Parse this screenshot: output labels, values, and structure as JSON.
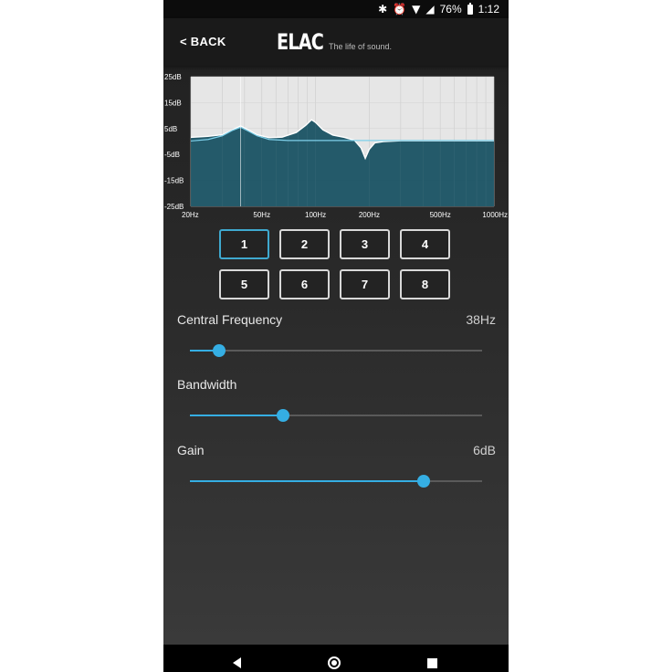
{
  "status_bar": {
    "battery_percent": "76%",
    "time": "1:12"
  },
  "header": {
    "back_label": "< BACK",
    "logo_text": "ELAC",
    "tagline": "The life of sound."
  },
  "chart_data": {
    "type": "area",
    "x_scale": "log",
    "xlim": [
      20,
      1000
    ],
    "ylim": [
      -25,
      25
    ],
    "x_ticks": [
      "20Hz",
      "50Hz",
      "100Hz",
      "200Hz",
      "500Hz",
      "1000Hz"
    ],
    "x_tick_values": [
      20,
      50,
      100,
      200,
      500,
      1000
    ],
    "y_ticks": [
      "25dB",
      "15dB",
      "5dB",
      "-5dB",
      "-15dB",
      "-25dB"
    ],
    "y_tick_values": [
      25,
      15,
      5,
      -5,
      -15,
      -25
    ],
    "grid": true,
    "selected_frequency": 38,
    "series": [
      {
        "x": [
          20,
          25,
          30,
          34,
          38,
          42,
          47,
          55,
          65,
          78,
          88,
          95,
          100,
          110,
          125,
          145,
          165,
          180,
          190,
          200,
          215,
          240,
          300,
          400,
          600,
          1000
        ],
        "y": [
          1.6,
          2,
          2.6,
          4.4,
          6,
          4.5,
          2.6,
          1.5,
          1.7,
          3.5,
          6.2,
          8.4,
          7.4,
          4.5,
          2.5,
          1.6,
          0.5,
          -2.5,
          -6.5,
          -3,
          -0.5,
          0,
          0.3,
          0.3,
          0.3,
          0.3
        ]
      },
      {
        "x": [
          20,
          25,
          30,
          34,
          38,
          42,
          47,
          55,
          70,
          100,
          150,
          200,
          300,
          500,
          1000
        ],
        "y": [
          0.2,
          0.8,
          2.2,
          4.2,
          5.5,
          4,
          2.2,
          0.8,
          0.4,
          0.4,
          0.4,
          0.4,
          0.4,
          0.4,
          0.4
        ]
      }
    ]
  },
  "eq_bands": {
    "selected": "1",
    "labels": [
      "1",
      "2",
      "3",
      "4",
      "5",
      "6",
      "7",
      "8"
    ]
  },
  "params": {
    "central_frequency": {
      "label": "Central Frequency",
      "value": "38Hz",
      "level": 0.1
    },
    "bandwidth": {
      "label": "Bandwidth",
      "value": "",
      "level": 0.32
    },
    "gain": {
      "label": "Gain",
      "value": "6dB",
      "level": 0.8
    }
  },
  "colors": {
    "accent": "#35aee3",
    "chart_fill": "#1d5565",
    "chart_background": "#e6e6e6",
    "curve": "#ffffff"
  }
}
